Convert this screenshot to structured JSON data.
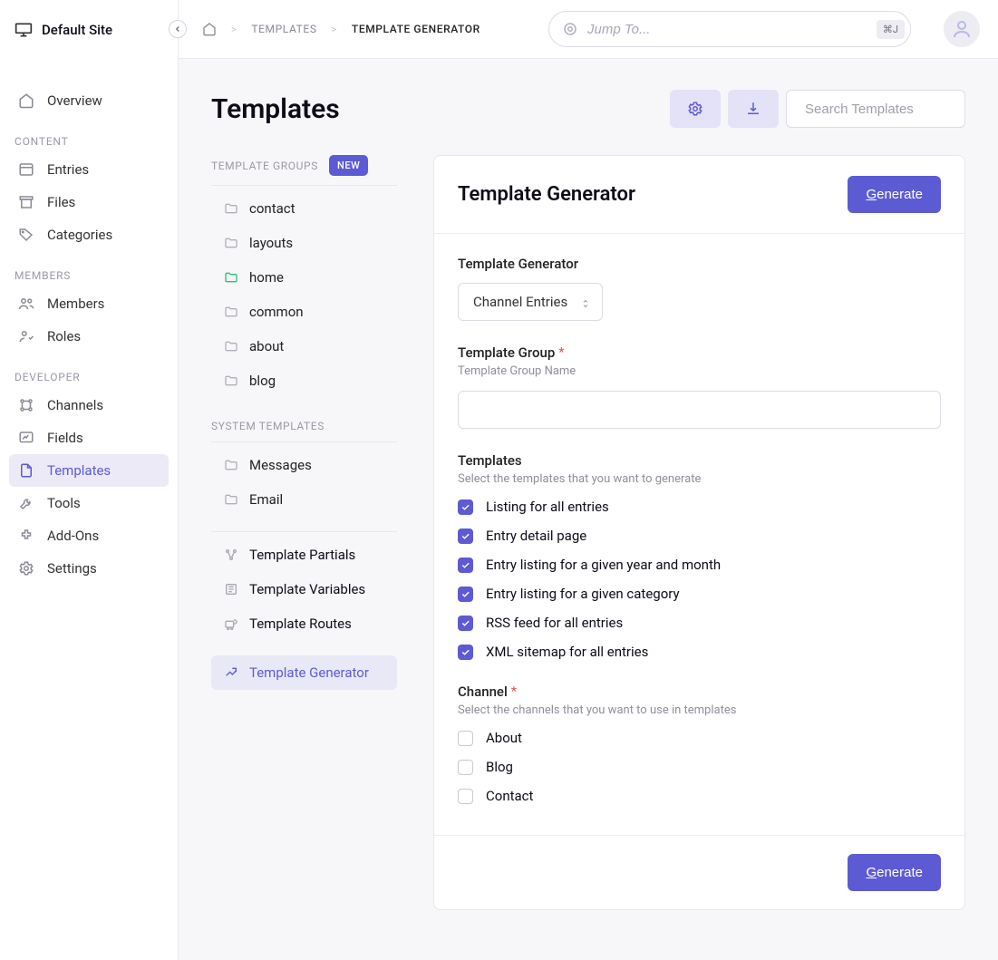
{
  "site_name": "Default Site",
  "breadcrumbs": [
    "TEMPLATES",
    "TEMPLATE GENERATOR"
  ],
  "jump": {
    "placeholder": "Jump To...",
    "kbd": "⌘J"
  },
  "sidebar": {
    "items": [
      {
        "label": "Overview"
      }
    ],
    "sections": [
      {
        "heading": "CONTENT",
        "items": [
          "Entries",
          "Files",
          "Categories"
        ]
      },
      {
        "heading": "MEMBERS",
        "items": [
          "Members",
          "Roles"
        ]
      },
      {
        "heading": "DEVELOPER",
        "items": [
          "Channels",
          "Fields",
          "Templates",
          "Tools",
          "Add-Ons",
          "Settings"
        ]
      }
    ]
  },
  "page": {
    "title": "Templates",
    "search_placeholder": "Search Templates"
  },
  "template_groups": {
    "heading": "TEMPLATE GROUPS",
    "new_badge": "NEW",
    "items": [
      "contact",
      "layouts",
      "home",
      "common",
      "about",
      "blog"
    ],
    "active_index": 2
  },
  "system_templates": {
    "heading": "SYSTEM TEMPLATES",
    "items": [
      "Messages",
      "Email"
    ]
  },
  "extras": {
    "items": [
      "Template Partials",
      "Template Variables",
      "Template Routes"
    ],
    "generator": "Template Generator"
  },
  "panel": {
    "title": "Template Generator",
    "generate_label_prefix": "G",
    "generate_label_rest": "enerate",
    "generator_field": {
      "label": "Template Generator",
      "value": "Channel Entries"
    },
    "group_field": {
      "label": "Template Group",
      "hint": "Template Group Name",
      "value": ""
    },
    "templates_field": {
      "label": "Templates",
      "hint": "Select the templates that you want to generate",
      "options": [
        {
          "label": "Listing for all entries",
          "checked": true
        },
        {
          "label": "Entry detail page",
          "checked": true
        },
        {
          "label": "Entry listing for a given year and month",
          "checked": true
        },
        {
          "label": "Entry listing for a given category",
          "checked": true
        },
        {
          "label": "RSS feed for all entries",
          "checked": true
        },
        {
          "label": "XML sitemap for all entries",
          "checked": true
        }
      ]
    },
    "channel_field": {
      "label": "Channel",
      "hint": "Select the channels that you want to use in templates",
      "options": [
        {
          "label": "About",
          "checked": false
        },
        {
          "label": "Blog",
          "checked": false
        },
        {
          "label": "Contact",
          "checked": false
        }
      ]
    }
  }
}
